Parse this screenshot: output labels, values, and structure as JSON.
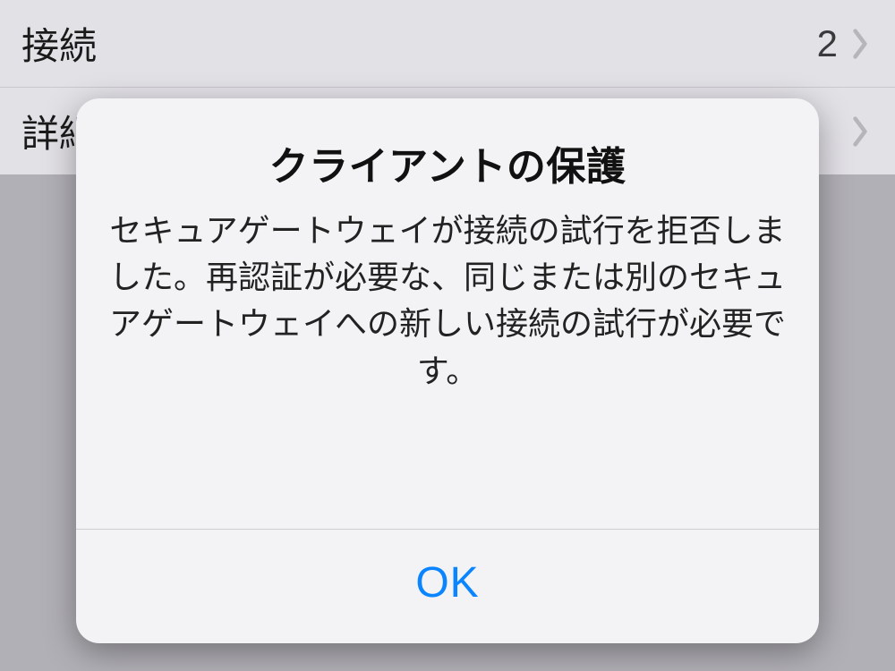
{
  "rows": [
    {
      "label": "接続",
      "value": "2"
    },
    {
      "label": "詳細",
      "value": ""
    }
  ],
  "alert": {
    "title": "クライアントの保護",
    "message": "セキュアゲートウェイが接続の試行を拒否しました。再認証が必要な、同じまたは別のセキュアゲートウェイへの新しい接続の試行が必要です。",
    "ok_label": "OK"
  }
}
